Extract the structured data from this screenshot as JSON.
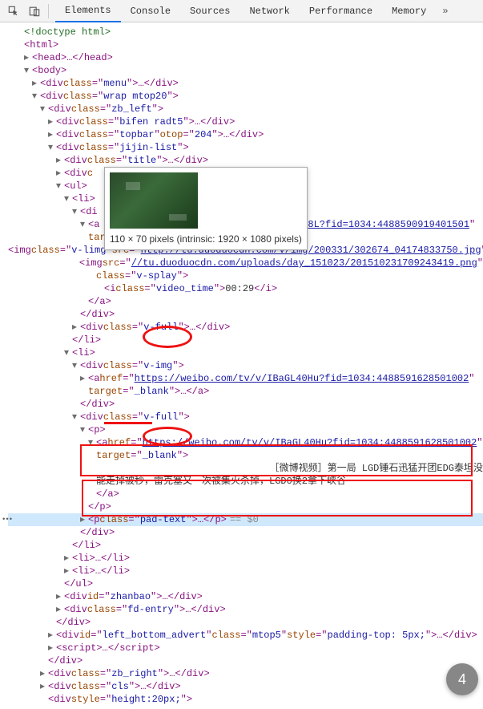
{
  "toolbar": {
    "tabs": [
      "Elements",
      "Console",
      "Sources",
      "Network",
      "Performance",
      "Memory"
    ],
    "active_tab": "Elements"
  },
  "tooltip": {
    "caption": "110 × 70 pixels (intrinsic: 1920 × 1080 pixels)"
  },
  "dom": {
    "doctype": "<!doctype html>",
    "html_open": "html",
    "head": "head",
    "body": "body",
    "menu": {
      "tag": "div",
      "cls": "menu"
    },
    "wrap": {
      "tag": "div",
      "cls": "wrap mtop20"
    },
    "zb_left": {
      "tag": "div",
      "cls": "zb_left"
    },
    "bifen": {
      "tag": "div",
      "cls": "bifen radt5"
    },
    "topbar": {
      "tag": "div",
      "cls": "topbar",
      "otop": "204"
    },
    "jijin": {
      "tag": "div",
      "cls": "jijin-list"
    },
    "title": {
      "tag": "div",
      "cls": "title"
    },
    "div_c": {
      "frag": "<div c"
    },
    "ul": "ul",
    "li": "li",
    "di_frag": "<di",
    "a_frag": "<a",
    "url_suffix": "8L?fid=1034:4488590919401501",
    "target_frag": "target=\"_blank\">",
    "img1": {
      "cls": "v-limg",
      "src": "http://tu.duoduocdn.com/v/img/200331/302674_04174833750.jpg",
      "alt": ""
    },
    "img2": {
      "src": "//tu.duoduocdn.com/uploads/day_151023/201510231709243419.png",
      "cls": "v-splay"
    },
    "i_time": {
      "cls": "video_time",
      "text": "00:29"
    },
    "a_close": "a",
    "div_close": "div",
    "v_full": {
      "tag": "div",
      "cls": "v-full"
    },
    "li_close": "li",
    "li2": "li",
    "v_img": {
      "tag": "div",
      "cls": "v-img"
    },
    "a2": {
      "href": "https://weibo.com/tv/v/IBaGL40Hu?fid=1034:4488591628501002",
      "target": "_blank"
    },
    "v_full2": {
      "tag": "div",
      "cls": "v-full"
    },
    "p": "p",
    "a3": {
      "href": "https://weibo.com/tv/v/IBaGL40Hu?fid=1034:4488591628501002",
      "target": "_blank"
    },
    "target2_frag": "target=\"_blank\">",
    "long_text_1": "［微博视频］第一局  LGD锤石迅猛开团EDG泰坦没",
    "long_text_2": "能走掉被秒，雷克塞又一次被集火杀掉，LGD0换2拿下峡谷",
    "p_pad": {
      "cls": "pad-text"
    },
    "eq0": "== $0",
    "li3": "li",
    "li4": "li",
    "ul_close": "ul",
    "zhanbao": {
      "tag": "div",
      "id": "zhanbao"
    },
    "fd_entry": {
      "tag": "div",
      "cls": "fd-entry"
    },
    "left_bottom": {
      "tag": "div",
      "id": "left_bottom_advert",
      "cls": "mtop5",
      "style": "padding-top: 5px;"
    },
    "script": "script",
    "zb_right": {
      "tag": "div",
      "cls": "zb_right"
    },
    "cls": {
      "tag": "div",
      "cls": "cls"
    },
    "last_frag": "<div style=\"height:20px;\">"
  },
  "fab": "4"
}
